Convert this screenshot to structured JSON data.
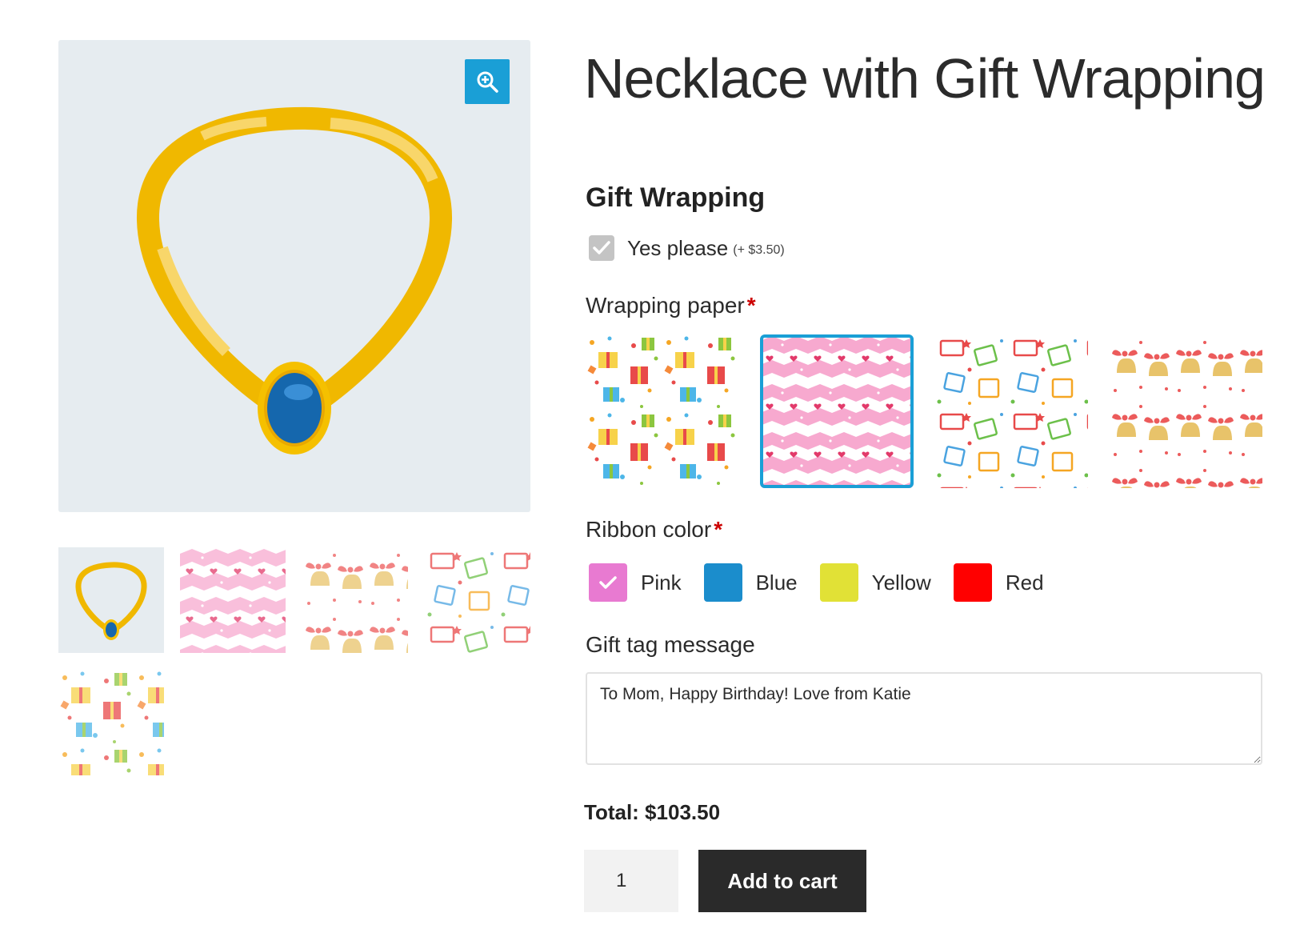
{
  "product": {
    "title": "Necklace with Gift Wrapping",
    "image_name": "necklace",
    "thumbnails": [
      {
        "name": "necklace"
      },
      {
        "name": "pink hearts wrapping paper"
      },
      {
        "name": "bells and bows wrapping paper"
      },
      {
        "name": "happy birthday wrapping paper"
      },
      {
        "name": "presents wrapping paper"
      }
    ]
  },
  "gift_wrapping": {
    "heading": "Gift Wrapping",
    "yes_label": "Yes please",
    "yes_price": "(+ $3.50)",
    "checked": true
  },
  "wrapping_paper": {
    "label": "Wrapping paper",
    "required_mark": "*",
    "options": [
      {
        "name": "presents",
        "selected": false
      },
      {
        "name": "pink hearts",
        "selected": true
      },
      {
        "name": "happy birthday",
        "selected": false
      },
      {
        "name": "bells and bows",
        "selected": false
      }
    ]
  },
  "ribbon": {
    "label": "Ribbon color",
    "required_mark": "*",
    "options": [
      {
        "label": "Pink",
        "color": "#e87ad1",
        "selected": true
      },
      {
        "label": "Blue",
        "color": "#1b8dcc",
        "selected": false
      },
      {
        "label": "Yellow",
        "color": "#e1e136",
        "selected": false
      },
      {
        "label": "Red",
        "color": "#ff0000",
        "selected": false
      }
    ]
  },
  "gift_tag": {
    "label": "Gift tag message",
    "value": "To Mom, Happy Birthday! Love from Katie"
  },
  "total": {
    "text": "Total: $103.50"
  },
  "cart": {
    "quantity": "1",
    "add_label": "Add to cart"
  },
  "colors": {
    "accent": "#1a9fd6",
    "image_bg": "#e6ecf0",
    "button_dark": "#2a2a2a",
    "necklace_gold": "#f0b800",
    "gem_blue": "#1567ad"
  }
}
